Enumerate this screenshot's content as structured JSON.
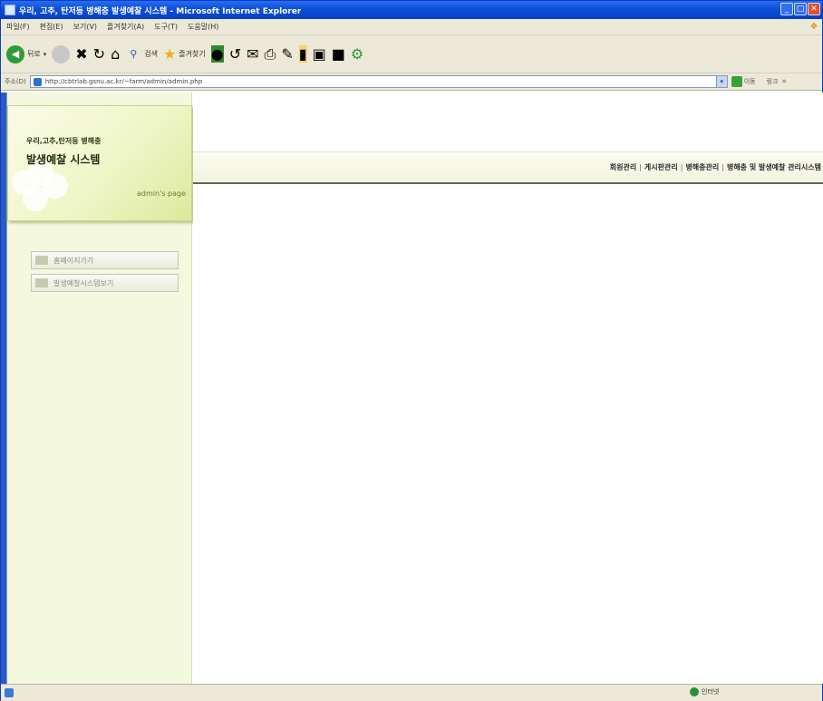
{
  "window": {
    "title": "우리, 고추, 탄저등 병해충 발생예찰 시스템 - Microsoft Internet Explorer",
    "controls": [
      "_",
      "□",
      "✕"
    ]
  },
  "menubar": {
    "items": [
      "파일(F)",
      "편집(E)",
      "보기(V)",
      "즐겨찾기(A)",
      "도구(T)",
      "도움말(H)"
    ]
  },
  "toolbar": {
    "back_label": "뒤로",
    "search_label": "검색",
    "favorites_label": "즐겨찾기"
  },
  "address": {
    "label": "주소(D)",
    "url": "http://cbtrlab.gsnu.ac.kr/~farm/admin/admin.php",
    "go_label": "이동",
    "links_label": "링크"
  },
  "sidebar": {
    "brand_line1": "우리,고추,탄저등 병해충",
    "brand_line2": "발생예찰 시스템",
    "admin_label": "admin's page",
    "items": [
      {
        "label": "홈페이지가기"
      },
      {
        "label": "발생예찰시스템보기"
      }
    ]
  },
  "topnav": {
    "items": [
      "회원관리",
      "게시판관리",
      "병해충관리",
      "병해충 및 발생예찰 관리시스템"
    ]
  },
  "statusbar": {
    "zone_label": "인터넷"
  },
  "colors": {
    "titlebar": "#0b4fd8",
    "sidebar_bg": "#f4f8df",
    "nav_border": "#5e6a45"
  }
}
